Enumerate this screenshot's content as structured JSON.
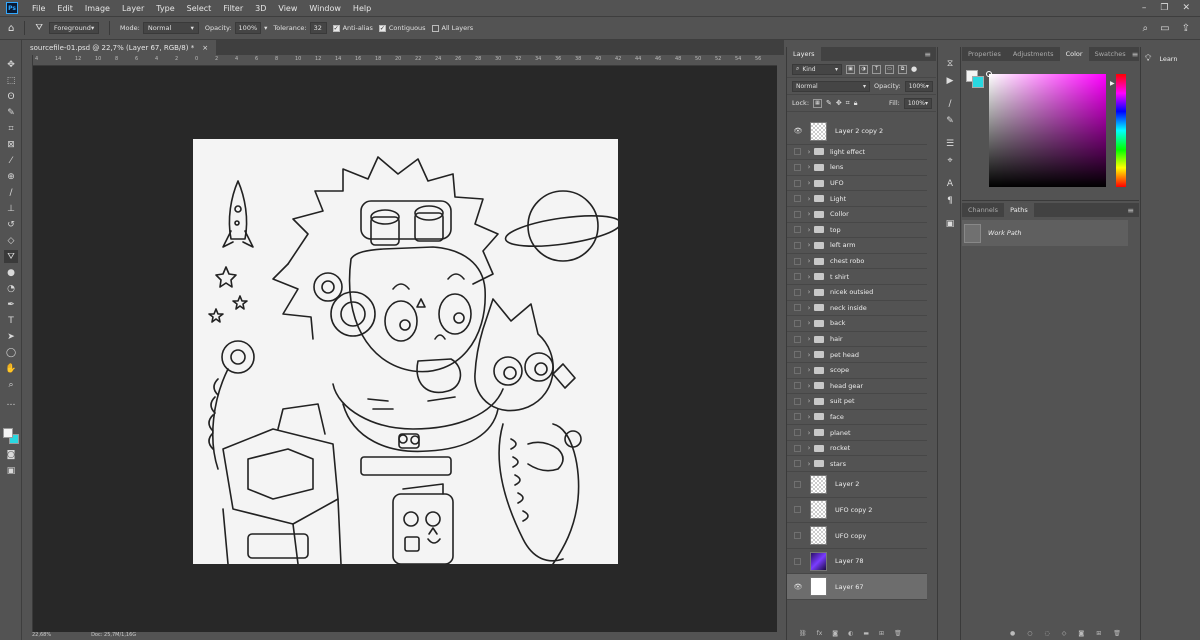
{
  "app": {
    "logo_text": "Ps"
  },
  "menu": [
    "File",
    "Edit",
    "Image",
    "Layer",
    "Type",
    "Select",
    "Filter",
    "3D",
    "View",
    "Window",
    "Help"
  ],
  "options": {
    "fill_source": "Foreground",
    "mode_label": "Mode:",
    "mode_value": "Normal",
    "opacity_label": "Opacity:",
    "opacity_value": "100%",
    "tolerance_label": "Tolerance:",
    "tolerance_value": "32",
    "anti_alias_label": "Anti-alias",
    "contiguous_label": "Contiguous",
    "all_layers_label": "All Layers"
  },
  "document": {
    "tab_title": "sourcefile-01.psd @ 22,7% (Layer 67, RGB/8) *",
    "close": "×",
    "ruler_ticks": [
      "4",
      "14",
      "12",
      "10",
      "8",
      "6",
      "4",
      "2",
      "0",
      "2",
      "4",
      "6",
      "8",
      "10",
      "12",
      "14",
      "16",
      "18",
      "20",
      "22",
      "24",
      "26",
      "28",
      "30",
      "32",
      "34",
      "36",
      "38",
      "40",
      "42",
      "44",
      "46",
      "48",
      "50",
      "52",
      "54",
      "56"
    ],
    "status_zoom": "22,68%",
    "status_doc": "Doc: 25,7M/1,16G"
  },
  "layers_panel": {
    "tab": "Layers",
    "kind_label": "Kind",
    "blend_mode": "Normal",
    "opacity_label": "Opacity:",
    "opacity_value": "100%",
    "lock_label": "Lock:",
    "fill_label": "Fill:",
    "fill_value": "100%",
    "layers": [
      {
        "name": "Layer 2 copy 2",
        "type": "layer",
        "visible": true,
        "thumb": "checker"
      },
      {
        "name": "light effect",
        "type": "group"
      },
      {
        "name": "lens",
        "type": "group"
      },
      {
        "name": "UFO",
        "type": "group"
      },
      {
        "name": "Light",
        "type": "group"
      },
      {
        "name": "Collor",
        "type": "group"
      },
      {
        "name": "top",
        "type": "group"
      },
      {
        "name": "left arm",
        "type": "group"
      },
      {
        "name": "chest robo",
        "type": "group"
      },
      {
        "name": "t shirt",
        "type": "group"
      },
      {
        "name": "nicek outsied",
        "type": "group"
      },
      {
        "name": "neck inside",
        "type": "group"
      },
      {
        "name": "back",
        "type": "group"
      },
      {
        "name": "hair",
        "type": "group"
      },
      {
        "name": "pet head",
        "type": "group"
      },
      {
        "name": "scope",
        "type": "group"
      },
      {
        "name": "head gear",
        "type": "group"
      },
      {
        "name": "suit pet",
        "type": "group"
      },
      {
        "name": "face",
        "type": "group"
      },
      {
        "name": "planet",
        "type": "group"
      },
      {
        "name": "rocket",
        "type": "group"
      },
      {
        "name": "stars",
        "type": "group"
      },
      {
        "name": "Layer 2",
        "type": "layer",
        "thumb": "checker"
      },
      {
        "name": "UFO copy 2",
        "type": "layer",
        "thumb": "checker"
      },
      {
        "name": "UFO copy",
        "type": "layer",
        "thumb": "checker"
      },
      {
        "name": "Layer 78",
        "type": "layer",
        "thumb": "purple"
      },
      {
        "name": "Layer 67",
        "type": "layer",
        "visible": true,
        "selected": true,
        "thumb": "white"
      }
    ]
  },
  "color_panel": {
    "tabs": [
      "Properties",
      "Adjustments",
      "Color",
      "Swatches"
    ],
    "active_tab": "Color",
    "foreground": "#f4f4f4",
    "background": "#29d8e0"
  },
  "paths_panel": {
    "tabs": [
      "Channels",
      "Paths"
    ],
    "active_tab": "Paths",
    "items": [
      "Work Path"
    ]
  },
  "learn": {
    "label": "Learn"
  }
}
